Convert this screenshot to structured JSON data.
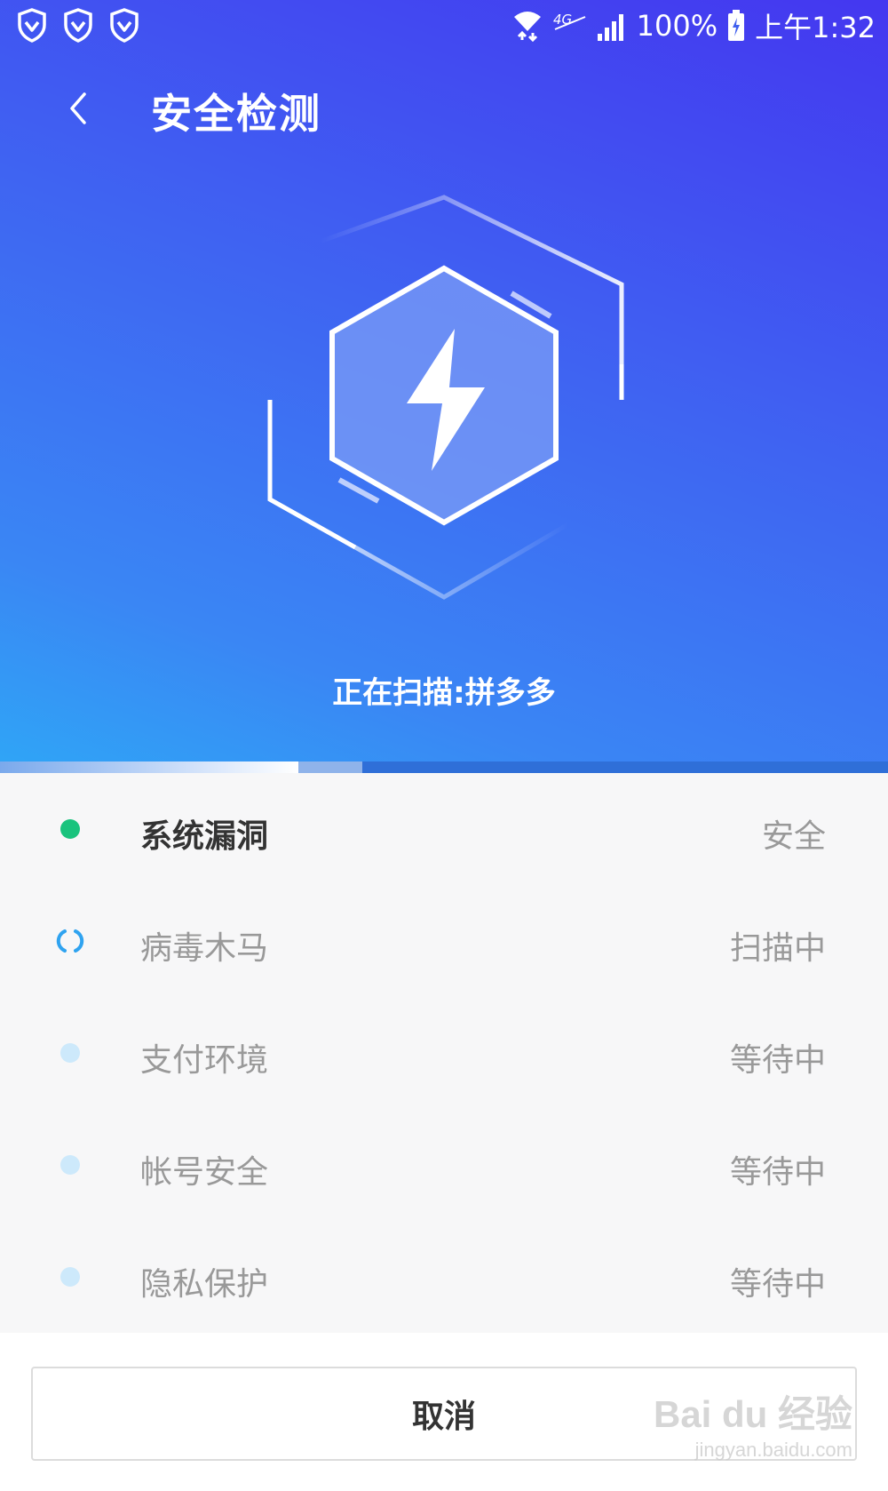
{
  "status_bar": {
    "network_label": "4G",
    "battery": "100%",
    "time": "上午1:32",
    "left_icons": [
      "shield-icon",
      "shield-icon",
      "shield-icon"
    ]
  },
  "header": {
    "title": "安全检测",
    "back_icon": "chevron-left-icon"
  },
  "scan": {
    "status_text": "正在扫描:拼多多",
    "progress_fraction": 0.336
  },
  "items": [
    {
      "label": "系统漏洞",
      "status": "安全",
      "indicator": "done",
      "color": "#19c37d"
    },
    {
      "label": "病毒木马",
      "status": "扫描中",
      "indicator": "scanning",
      "color": "#2fa3f0"
    },
    {
      "label": "支付环境",
      "status": "等待中",
      "indicator": "waiting",
      "color": "#cde9fb"
    },
    {
      "label": "帐号安全",
      "status": "等待中",
      "indicator": "waiting",
      "color": "#cde9fb"
    },
    {
      "label": "隐私保护",
      "status": "等待中",
      "indicator": "waiting",
      "color": "#cde9fb"
    }
  ],
  "footer": {
    "cancel_label": "取消",
    "watermark_main": "Bai du 经验",
    "watermark_sub": "jingyan.baidu.com"
  },
  "colors": {
    "gradient_top": "#4437f0",
    "gradient_bottom": "#2fa6f6",
    "safe": "#19c37d",
    "scanning": "#2fa3f0",
    "waiting": "#cde9fb"
  }
}
